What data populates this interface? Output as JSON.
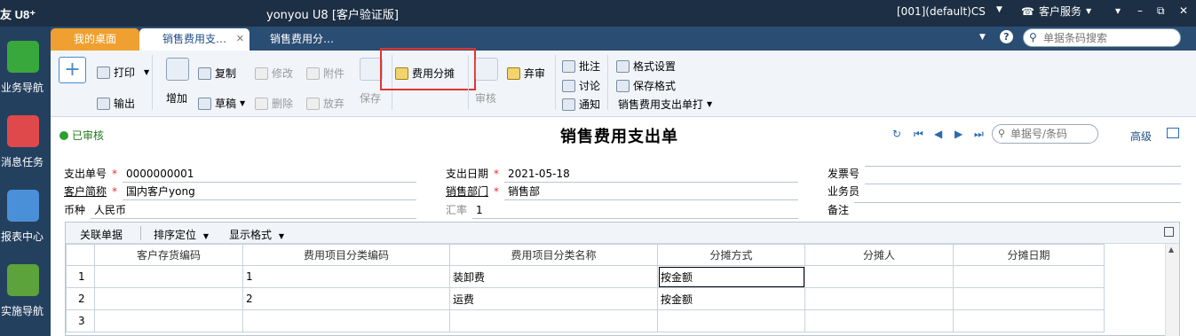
{
  "titlebar": {
    "logo": "友 U8⁺",
    "title": "yonyou U8 [客户验证版]",
    "account": "[001](default)CS",
    "service": "客户服务",
    "min": "–",
    "restore": "⧉",
    "close": "✕"
  },
  "sidebar": {
    "items": [
      {
        "label": "业务导航",
        "color": "#38a83d"
      },
      {
        "label": "消息任务",
        "color": "#e0494b"
      },
      {
        "label": "报表中心",
        "color": "#4a90d9"
      },
      {
        "label": "实施导航",
        "color": "#5ba33a"
      }
    ]
  },
  "tabs": {
    "items": [
      "我的桌面",
      "销售费用支…",
      "销售费用分…"
    ],
    "close": "✕",
    "search_placeholder": "单据条码搜索"
  },
  "toolbar": {
    "print": "打印",
    "export": "输出",
    "add": "增加",
    "copy": "复制",
    "draft": "草稿",
    "modify": "修改",
    "attach": "附件",
    "delete": "删除",
    "abandon": "放弃",
    "save": "保存",
    "allocate": "费用分摊",
    "audit": "审核",
    "unaudit": "弃审",
    "annotate": "批注",
    "discuss": "讨论",
    "notify": "通知",
    "format_setting": "格式设置",
    "save_format": "保存格式",
    "print_template": "销售费用支出单打"
  },
  "status": {
    "audited": "已审核",
    "form_title": "销售费用支出单",
    "search_placeholder": "单据号/条码",
    "advanced": "高级"
  },
  "header": {
    "doc_no_label": "支出单号",
    "doc_no": "0000000001",
    "date_label": "支出日期",
    "date": "2021-05-18",
    "invoice_label": "发票号",
    "invoice": "",
    "customer_label": "客户简称",
    "customer": "国内客户yong",
    "dept_label": "销售部门",
    "dept": "销售部",
    "salesman_label": "业务员",
    "salesman": "",
    "currency_label": "币种",
    "currency": "人民币",
    "rate_label": "汇率",
    "rate": "1",
    "remark_label": "备注",
    "remark": ""
  },
  "grid": {
    "toolbar": {
      "related": "关联单据",
      "sort": "排序定位",
      "display": "显示格式"
    },
    "columns": [
      "客户存货编码",
      "费用项目分类编码",
      "费用项目分类名称",
      "分摊方式",
      "分摊人",
      "分摊日期"
    ],
    "rows": [
      {
        "n": "1",
        "cust_code": "",
        "code": "1",
        "name": "装卸费",
        "method": "按金额",
        "person": "",
        "date": ""
      },
      {
        "n": "2",
        "cust_code": "",
        "code": "2",
        "name": "运费",
        "method": "按金额",
        "person": "",
        "date": ""
      },
      {
        "n": "3",
        "cust_code": "",
        "code": "",
        "name": "",
        "method": "",
        "person": "",
        "date": ""
      }
    ]
  }
}
